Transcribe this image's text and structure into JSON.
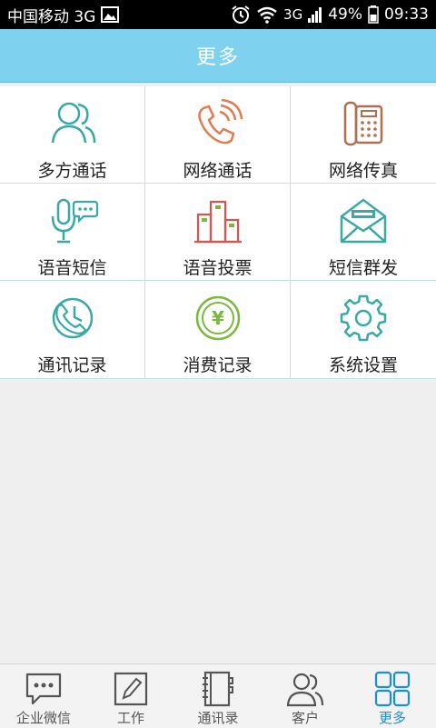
{
  "status_bar": {
    "carrier": "中国移动 3G",
    "network": "3G",
    "battery": "49%",
    "time": "09:33"
  },
  "header": {
    "title": "更多"
  },
  "grid": {
    "items": [
      {
        "label": "多方通话",
        "icon": "multi-party-call-icon"
      },
      {
        "label": "网络通话",
        "icon": "network-call-icon"
      },
      {
        "label": "网络传真",
        "icon": "network-fax-icon"
      },
      {
        "label": "语音短信",
        "icon": "voice-sms-icon"
      },
      {
        "label": "语音投票",
        "icon": "voice-vote-icon"
      },
      {
        "label": "短信群发",
        "icon": "sms-broadcast-icon"
      },
      {
        "label": "通讯记录",
        "icon": "call-log-icon"
      },
      {
        "label": "消费记录",
        "icon": "expense-record-icon"
      },
      {
        "label": "系统设置",
        "icon": "settings-gear-icon"
      }
    ]
  },
  "tabbar": {
    "tabs": [
      {
        "label": "企业微信",
        "icon": "chat-bubble-icon",
        "active": false
      },
      {
        "label": "工作",
        "icon": "pen-edit-icon",
        "active": false
      },
      {
        "label": "通讯录",
        "icon": "address-book-icon",
        "active": false
      },
      {
        "label": "客户",
        "icon": "customers-icon",
        "active": false
      },
      {
        "label": "更多",
        "icon": "grid-more-icon",
        "active": true
      }
    ]
  },
  "colors": {
    "header_bg": "#7ed2ef",
    "teal": "#3aa9a6",
    "orange": "#e07b52",
    "brown": "#b06f4d",
    "red": "#d9534f",
    "green": "#7ab83f",
    "active_tab": "#1a8fd6"
  }
}
